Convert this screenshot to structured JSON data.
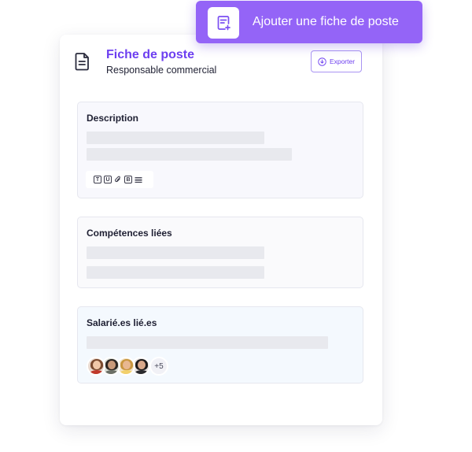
{
  "header": {
    "title": "Fiche de poste",
    "subtitle": "Responsable commercial",
    "export_label": "Exporter"
  },
  "sections": {
    "description": {
      "title": "Description",
      "toolbar": [
        "T",
        "U",
        "paperclip-icon",
        "B",
        "align-icon"
      ]
    },
    "competences": {
      "title": "Compétences liées"
    },
    "salaries": {
      "title": "Salarié.es lié.es",
      "more_count": "+5"
    }
  },
  "add_button": {
    "label": "Ajouter une fiche de poste"
  },
  "colors": {
    "accent": "#6d3ff0",
    "add_button_bg": "#9464f7",
    "skeleton": "#e8e9ee"
  }
}
